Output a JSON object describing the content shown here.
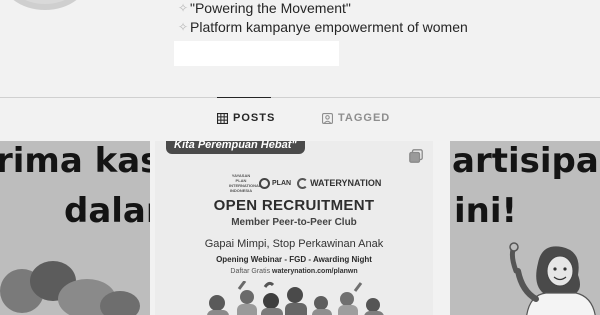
{
  "profile": {
    "bio_lines": [
      "\"Powering the Movement\"",
      "Platform kampanye empowerment of women"
    ]
  },
  "tabs": [
    {
      "label": "POSTS",
      "icon": "grid-icon",
      "active": true
    },
    {
      "label": "TAGGED",
      "icon": "tagged-icon",
      "active": false
    }
  ],
  "grid": {
    "left_tile": {
      "line1": "rima kas",
      "line2": "dalar"
    },
    "center_tile": {
      "ribbon": "Kita Perempuan Hebat\"",
      "logo_small": "YAYASAN PLAN INTERNATIONAL INDONESIA",
      "logo_plan": "PLAN",
      "logo_water": "WATERYNATION",
      "title": "OPEN RECRUITMENT",
      "subtitle": "Member Peer-to-Peer Club",
      "tagline": "Gapai Mimpi, Stop Perkawinan Anak",
      "events": "Opening Webinar - FGD - Awarding Night",
      "daftar_prefix": "Daftar Gratis",
      "daftar_url": "waterynation.com/planwn",
      "icon": "multi-image-icon"
    },
    "right_tile": {
      "line1": "artisipa",
      "line2": "ini!"
    }
  },
  "colors": {
    "background": "#f2f2f2",
    "text": "#262626",
    "muted": "#8e8e8e",
    "divider": "#d0d0d0"
  }
}
